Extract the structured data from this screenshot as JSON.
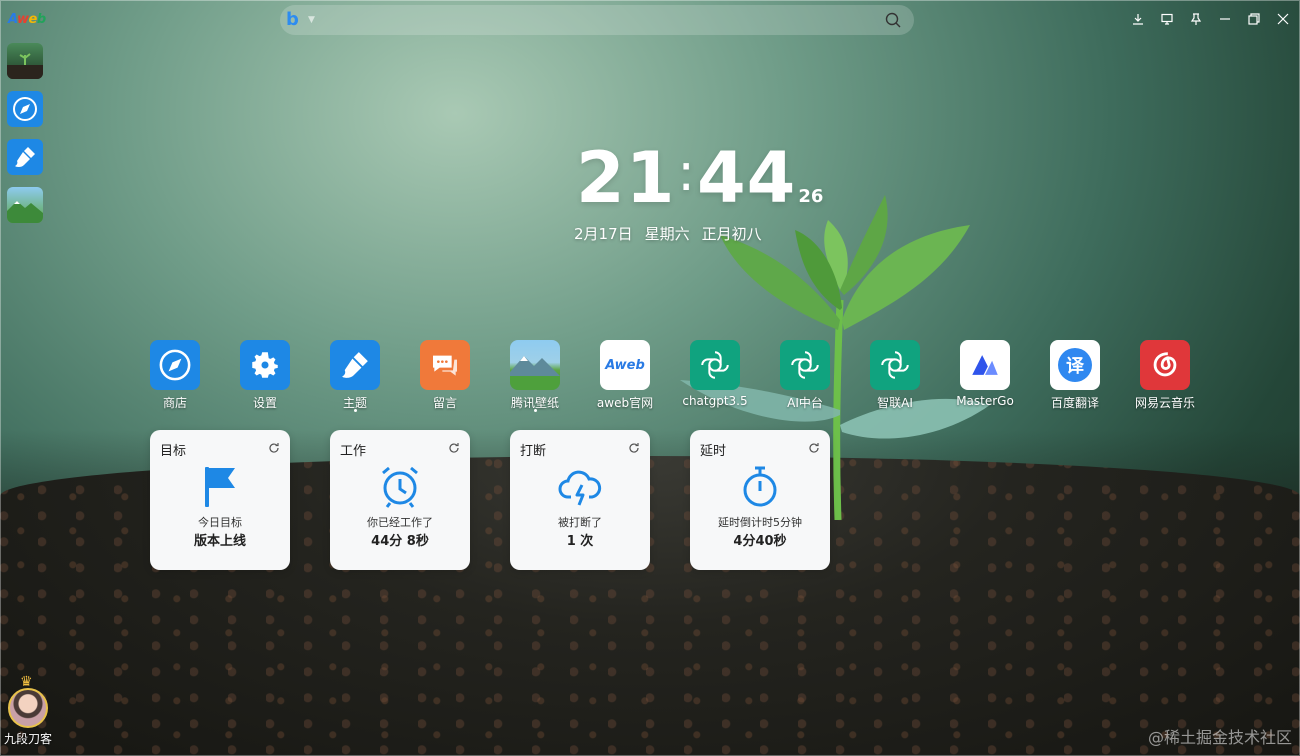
{
  "topbar": {
    "logo": [
      "A",
      "w",
      "e",
      "b"
    ],
    "search_engine": "b"
  },
  "clock": {
    "hours": "21",
    "minutes": "44",
    "seconds": "26"
  },
  "date": {
    "day": "2月17日",
    "weekday": "星期六",
    "lunar": "正月初八"
  },
  "apps": [
    {
      "label": "商店",
      "icon": "compass-icon"
    },
    {
      "label": "设置",
      "icon": "gear-icon"
    },
    {
      "label": "主题",
      "icon": "brush-icon"
    },
    {
      "label": "留言",
      "icon": "message-icon"
    },
    {
      "label": "腾讯壁纸",
      "icon": "landscape-icon"
    },
    {
      "label": "aweb官网",
      "icon": "aweb-logo-icon"
    },
    {
      "label": "chatgpt3.5",
      "icon": "openai-icon"
    },
    {
      "label": "AI中台",
      "icon": "openai-icon"
    },
    {
      "label": "智联AI",
      "icon": "openai-icon"
    },
    {
      "label": "MasterGo",
      "icon": "mastergo-icon"
    },
    {
      "label": "百度翻译",
      "icon": "translate-icon"
    },
    {
      "label": "网易云音乐",
      "icon": "netease-music-icon"
    }
  ],
  "app_logos": {
    "aweb_text": "Aweb",
    "translate_glyph": "译"
  },
  "widgets": [
    {
      "title": "目标",
      "desc": "今日目标",
      "value": "版本上线",
      "icon": "flag-icon"
    },
    {
      "title": "工作",
      "desc": "你已经工作了",
      "value": "44分 8秒",
      "icon": "alarm-clock-icon"
    },
    {
      "title": "打断",
      "desc": "被打断了",
      "value": "1 次",
      "icon": "thunder-cloud-icon"
    },
    {
      "title": "延时",
      "desc": "延时倒计时5分钟",
      "value": "4分40秒",
      "icon": "stopwatch-icon"
    }
  ],
  "user": {
    "name": "九段刀客"
  },
  "watermark": "@稀土掘金技术社区",
  "colors": {
    "accent_blue": "#1e88e5",
    "card_bg": "#f7f8f9",
    "openai_green": "#10a37f",
    "netease_red": "#e0373a",
    "orange": "#f0793a"
  }
}
